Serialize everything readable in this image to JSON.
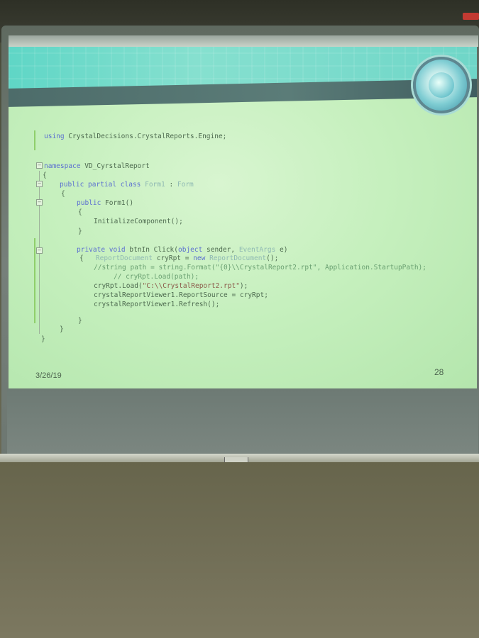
{
  "slide": {
    "date": "3/26/19",
    "page_number": "28",
    "code_lines": [
      {
        "segments": [
          {
            "t": "using",
            "c": "kw"
          },
          {
            "t": " CrystalDecisions.CrystalReports.Engine;",
            "c": ""
          }
        ]
      },
      {
        "segments": [
          {
            "t": "namespace",
            "c": "kw"
          },
          {
            "t": " VD_CyrstalReport",
            "c": ""
          }
        ]
      },
      {
        "segments": [
          {
            "t": "{",
            "c": ""
          }
        ]
      },
      {
        "segments": [
          {
            "t": "public partial class",
            "c": "kw"
          },
          {
            "t": " Form1",
            "c": "ty"
          },
          {
            "t": " : ",
            "c": ""
          },
          {
            "t": "Form",
            "c": "ty"
          }
        ]
      },
      {
        "segments": [
          {
            "t": "{",
            "c": ""
          }
        ]
      },
      {
        "segments": [
          {
            "t": "public",
            "c": "kw"
          },
          {
            "t": " Form1()",
            "c": ""
          }
        ]
      },
      {
        "segments": [
          {
            "t": "{",
            "c": ""
          }
        ]
      },
      {
        "segments": [
          {
            "t": "InitializeComponent();",
            "c": ""
          }
        ]
      },
      {
        "segments": [
          {
            "t": "}",
            "c": ""
          }
        ]
      },
      {
        "segments": [
          {
            "t": "private void",
            "c": "kw"
          },
          {
            "t": " btnIn Click(",
            "c": ""
          },
          {
            "t": "object",
            "c": "kw"
          },
          {
            "t": " sender, ",
            "c": ""
          },
          {
            "t": "EventArgs",
            "c": "ty"
          },
          {
            "t": " e)",
            "c": ""
          }
        ]
      },
      {
        "segments": [
          {
            "t": "{   ",
            "c": ""
          },
          {
            "t": "ReportDocument",
            "c": "ty"
          },
          {
            "t": " cryRpt = ",
            "c": ""
          },
          {
            "t": "new",
            "c": "kw"
          },
          {
            "t": " ReportDocument",
            "c": "ty"
          },
          {
            "t": "();",
            "c": ""
          }
        ]
      },
      {
        "segments": [
          {
            "t": "//string path = string.Format(\"{0}\\\\CrystalReport2.rpt\", Application.StartupPath);",
            "c": "cm"
          }
        ]
      },
      {
        "segments": [
          {
            "t": "// cryRpt.Load(path);",
            "c": "cm"
          }
        ]
      },
      {
        "segments": [
          {
            "t": "cryRpt.Load(",
            "c": ""
          },
          {
            "t": "\"C:\\\\CrystalReport2.rpt\"",
            "c": "st"
          },
          {
            "t": ");",
            "c": ""
          }
        ]
      },
      {
        "segments": [
          {
            "t": "crystalReportViewer1.ReportSource = cryRpt;",
            "c": ""
          }
        ]
      },
      {
        "segments": [
          {
            "t": "crystalReportViewer1.Refresh();",
            "c": ""
          }
        ]
      },
      {
        "segments": [
          {
            "t": "}",
            "c": ""
          }
        ]
      },
      {
        "segments": [
          {
            "t": "}",
            "c": ""
          }
        ]
      },
      {
        "segments": [
          {
            "t": "}",
            "c": ""
          }
        ]
      }
    ]
  }
}
